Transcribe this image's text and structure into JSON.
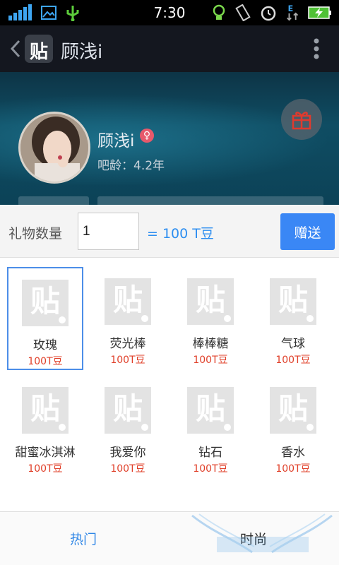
{
  "status_bar": {
    "time": "7:30"
  },
  "nav": {
    "logo_char": "贴",
    "title": "顾浅i"
  },
  "profile": {
    "name": "顾浅i",
    "gender_symbol": "♀",
    "bar_age": "吧龄：4.2年"
  },
  "gift_panel": {
    "quantity_label": "礼物数量",
    "quantity_value": "1",
    "total_text": "= 100 T豆",
    "send_label": "赠送",
    "gifts": [
      {
        "name": "玫瑰",
        "price": "100T豆",
        "selected": true
      },
      {
        "name": "荧光棒",
        "price": "100T豆"
      },
      {
        "name": "棒棒糖",
        "price": "100T豆"
      },
      {
        "name": "气球",
        "price": "100T豆"
      },
      {
        "name": "甜蜜冰淇淋",
        "price": "100T豆"
      },
      {
        "name": "我爱你",
        "price": "100T豆"
      },
      {
        "name": "钻石",
        "price": "100T豆"
      },
      {
        "name": "香水",
        "price": "100T豆"
      }
    ],
    "tabs": [
      {
        "label": "热门",
        "active": true
      },
      {
        "label": "时尚"
      }
    ]
  },
  "colors": {
    "accent_blue": "#3a87f5",
    "price_red": "#e0402a",
    "nav_bg": "#14171f"
  }
}
